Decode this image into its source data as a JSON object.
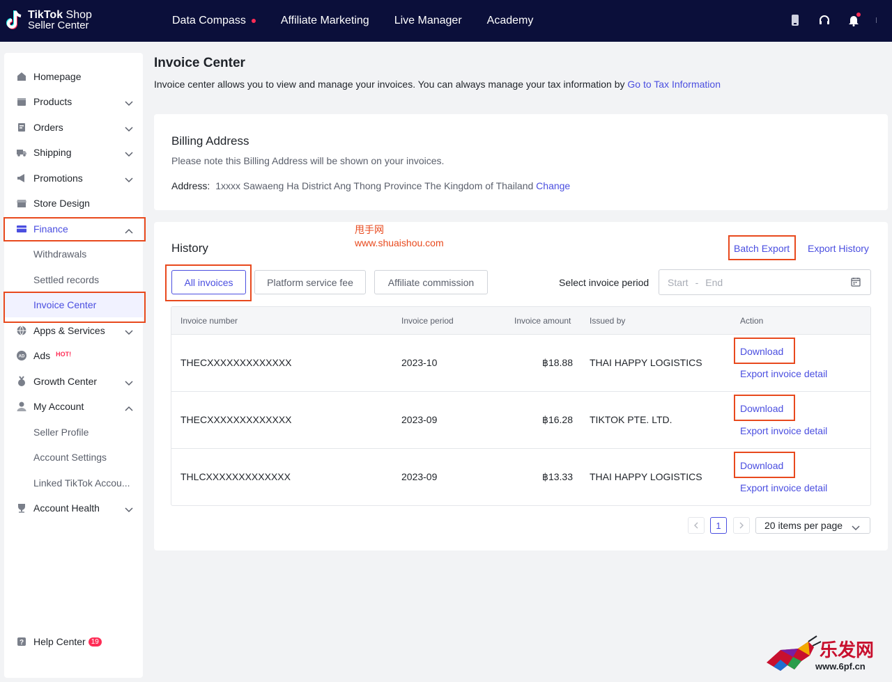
{
  "brand": {
    "name_bold": "TikTok",
    "name_rest": " Shop",
    "subtitle": "Seller Center"
  },
  "topnav": [
    {
      "label": "Data Compass",
      "dot": true
    },
    {
      "label": "Affiliate Marketing"
    },
    {
      "label": "Live Manager"
    },
    {
      "label": "Academy"
    }
  ],
  "sidebar": {
    "items": [
      {
        "label": "Homepage"
      },
      {
        "label": "Products"
      },
      {
        "label": "Orders"
      },
      {
        "label": "Shipping"
      },
      {
        "label": "Promotions"
      },
      {
        "label": "Store Design"
      },
      {
        "label": "Finance"
      },
      {
        "label": "Withdrawals"
      },
      {
        "label": "Settled records"
      },
      {
        "label": "Invoice Center"
      },
      {
        "label": "Apps & Services"
      },
      {
        "label": "Ads",
        "badge": "HOT!"
      },
      {
        "label": "Growth Center"
      },
      {
        "label": "My Account"
      },
      {
        "label": "Seller Profile"
      },
      {
        "label": "Account Settings"
      },
      {
        "label": "Linked TikTok Accou..."
      },
      {
        "label": "Account Health"
      }
    ],
    "help": {
      "label": "Help Center",
      "count": "19"
    }
  },
  "page": {
    "title": "Invoice Center",
    "description": "Invoice center allows you to view and manage your invoices. You can always manage your tax information by ",
    "tax_link": "Go to Tax Information"
  },
  "billing": {
    "title": "Billing Address",
    "note": "Please note this Billing Address will be shown on your invoices.",
    "address_label": "Address:",
    "address_value": "1xxxx Sawaeng Ha District Ang Thong Province The Kingdom of Thailand ",
    "change_link": "Change"
  },
  "history": {
    "title": "History",
    "watermark_cn": "甩手网",
    "watermark_url": "www.shuaishou.com",
    "batch_export": "Batch Export",
    "export_history": "Export History",
    "tabs": [
      "All invoices",
      "Platform service fee",
      "Affiliate commission"
    ],
    "active_tab": "All invoices",
    "period_label": "Select invoice period",
    "range_start_placeholder": "Start",
    "range_end_placeholder": "End",
    "columns": [
      "Invoice number",
      "Invoice period",
      "Invoice amount",
      "Issued by",
      "Action"
    ],
    "rows": [
      {
        "number": "THECXXXXXXXXXXXXX",
        "period": "2023-10",
        "amount": "฿18.88",
        "issuer": "THAI HAPPY LOGISTICS",
        "download": "Download",
        "export": "Export invoice detail"
      },
      {
        "number": "THECXXXXXXXXXXXXX",
        "period": "2023-09",
        "amount": "฿16.28",
        "issuer": "TIKTOK PTE. LTD.",
        "download": "Download",
        "export": "Export invoice detail"
      },
      {
        "number": "THLCXXXXXXXXXXXXX",
        "period": "2023-09",
        "amount": "฿13.33",
        "issuer": "THAI HAPPY LOGISTICS",
        "download": "Download",
        "export": "Export invoice detail"
      }
    ],
    "pagination": {
      "current_page": "1",
      "page_size": "20 items per page"
    }
  },
  "corner_watermark": {
    "text": "乐发网",
    "url": "www.6pf.cn"
  },
  "colors": {
    "accent": "#4a4ee0",
    "topbar": "#0b0f3a",
    "highlight_box": "#e8491d",
    "brand_red": "#fe2c55"
  }
}
